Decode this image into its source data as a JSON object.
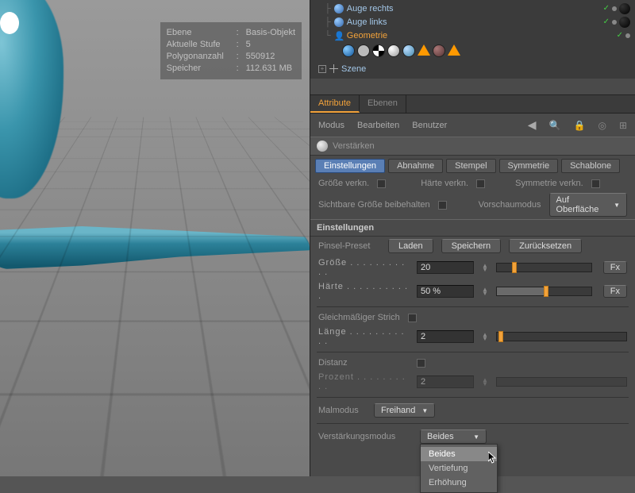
{
  "hud": {
    "k1": "Ebene",
    "v1": "Basis-Objekt",
    "k2": "Aktuelle Stufe",
    "v2": "5",
    "k3": "Polygonanzahl",
    "v3": "550912",
    "k4": "Speicher",
    "v4": "112.631 MB"
  },
  "objects": {
    "eye_r": "Auge rechts",
    "eye_l": "Auge links",
    "geom": "Geometrie",
    "scene": "Szene"
  },
  "attribute": {
    "tab_attr": "Attribute",
    "tab_layers": "Ebenen",
    "menu": {
      "modus": "Modus",
      "bearb": "Bearbeiten",
      "benutzer": "Benutzer"
    },
    "tool": "Verstärken",
    "subtabs": {
      "einst": "Einstellungen",
      "abnahme": "Abnahme",
      "stempel": "Stempel",
      "symm": "Symmetrie",
      "schab": "Schablone"
    },
    "link_size": "Größe verkn.",
    "link_hard": "Härte verkn.",
    "link_sym": "Symmetrie verkn.",
    "keep_size": "Sichtbare Größe beibehalten",
    "preview_mode": "Vorschaumodus",
    "preview_value": "Auf Oberfläche",
    "section": "Einstellungen",
    "preset_lbl": "Pinsel-Preset",
    "btn_load": "Laden",
    "btn_save": "Speichern",
    "btn_reset": "Zurücksetzen",
    "size_lbl": "Größe",
    "size_val": "20",
    "hard_lbl": "Härte",
    "hard_val": "50 %",
    "fx": "Fx",
    "stroke": "Gleichmäßiger Strich",
    "length_lbl": "Länge",
    "length_val": "2",
    "dist_lbl": "Distanz",
    "perc_lbl": "Prozent",
    "perc_val": "2",
    "paintmode_lbl": "Malmodus",
    "paintmode_val": "Freihand",
    "amplify_lbl": "Verstärkungsmodus",
    "amplify_val": "Beides",
    "dd_opts": {
      "o1": "Beides",
      "o2": "Vertiefung",
      "o3": "Erhöhung"
    }
  }
}
